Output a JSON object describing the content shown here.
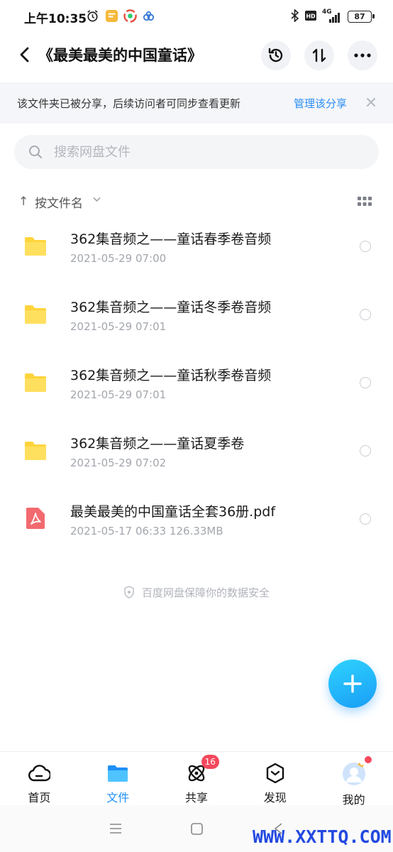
{
  "status_bar": {
    "time": "上午10:35",
    "network": "4G",
    "battery": "87"
  },
  "header": {
    "title": "《最美最美的中国童话》",
    "back_icon": "chevron-left-icon",
    "history_icon": "history-icon",
    "sort_icon": "sort-arrows-icon",
    "more_icon": "more-dots-icon"
  },
  "banner": {
    "text": "该文件夹已被分享，后续访问者可同步查看更新",
    "link": "管理该分享"
  },
  "search": {
    "placeholder": "搜索网盘文件"
  },
  "sort": {
    "arrow": "↑",
    "label": "按文件名"
  },
  "files": [
    {
      "name": "362集音频之——童话春季卷音频",
      "meta": "2021-05-29  07:00",
      "type": "folder"
    },
    {
      "name": "362集音频之——童话冬季卷音频",
      "meta": "2021-05-29  07:01",
      "type": "folder"
    },
    {
      "name": "362集音频之——童话秋季卷音频",
      "meta": "2021-05-29  07:01",
      "type": "folder"
    },
    {
      "name": "362集音频之——童话夏季卷",
      "meta": "2021-05-29  07:02",
      "type": "folder"
    },
    {
      "name": "最美最美的中国童话全套36册.pdf",
      "meta": "2021-05-17  06:33  126.33MB",
      "type": "pdf"
    }
  ],
  "safety_note": "百度网盘保障你的数据安全",
  "bottom_nav": {
    "items": [
      {
        "label": "首页",
        "icon": "cloud-icon"
      },
      {
        "label": "文件",
        "icon": "folder-icon"
      },
      {
        "label": "共享",
        "icon": "share-orbit-icon",
        "badge": "16"
      },
      {
        "label": "发现",
        "icon": "discover-box-icon"
      },
      {
        "label": "我的",
        "icon": "avatar-icon"
      }
    ]
  },
  "colors": {
    "accent": "#1f8ff6",
    "folder": "#ffd43b",
    "pdf": "#f26a6f",
    "badge": "#f4485c"
  },
  "watermark": "WWW.XXTTQ.COM"
}
